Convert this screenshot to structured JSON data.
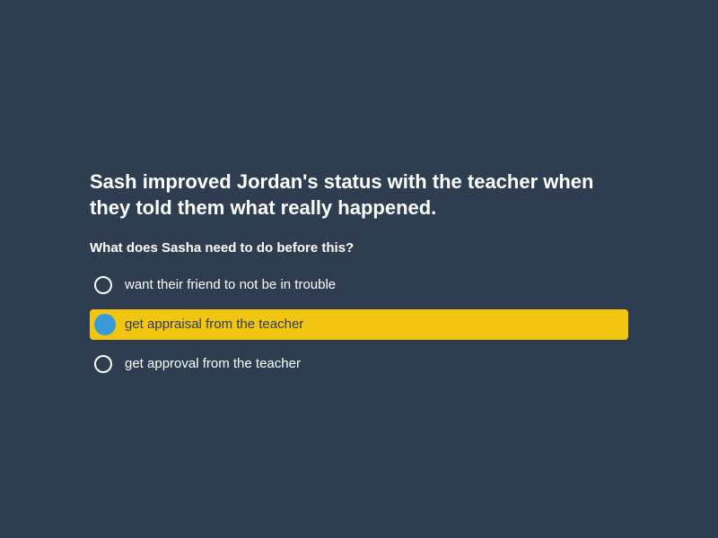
{
  "prompt": "Sash improved Jordan's status with the teacher when they told them what really happened.",
  "question": "What does Sasha need to do before this?",
  "options": [
    {
      "label": "want their friend to not be in trouble",
      "selected": false
    },
    {
      "label": "get appraisal from the teacher",
      "selected": true
    },
    {
      "label": "get approval from the teacher",
      "selected": false
    }
  ],
  "colors": {
    "background": "#2e3e50",
    "selected_highlight": "#f2c511",
    "selected_radio": "#3a9ad9"
  }
}
